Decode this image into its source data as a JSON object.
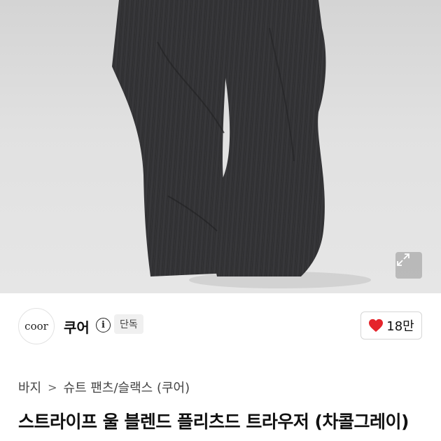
{
  "image": {
    "subject": "pants-photo",
    "expand_icon": "expand-arrows-icon"
  },
  "seller": {
    "logo_text": "coor",
    "name": "쿠어",
    "info_icon": "i",
    "badge": "단독"
  },
  "like": {
    "icon": "heart-icon",
    "count": "18만",
    "color": "#e5242b"
  },
  "breadcrumb": {
    "items": [
      "바지",
      "슈트 팬츠/슬랙스 (쿠어)"
    ],
    "separator": ">"
  },
  "product": {
    "title": "스트라이프 울 블렌드 플리츠드 트라우저 (차콜그레이)"
  }
}
